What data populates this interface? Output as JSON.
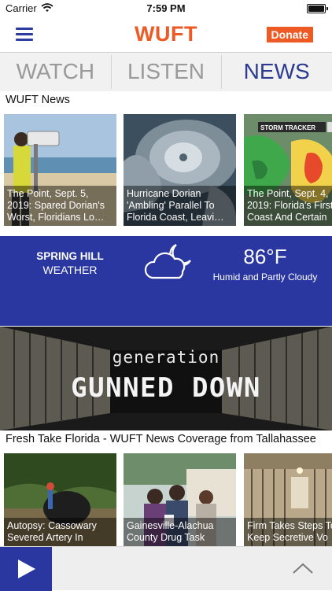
{
  "status_bar": {
    "carrier": "Carrier",
    "time": "7:59 PM"
  },
  "nav": {
    "logo": "WUFT",
    "donate_label": "Donate"
  },
  "tabs": [
    {
      "label": "WATCH"
    },
    {
      "label": "LISTEN"
    },
    {
      "label": "NEWS",
      "active": true
    }
  ],
  "news_section": {
    "title": "WUFT News",
    "items": [
      {
        "line1": "The Point, Sept. 5,",
        "line2": "2019: Spared Dorian's",
        "line3": "Worst, Floridians Lo…"
      },
      {
        "line1": "Hurricane Dorian",
        "line2": "'Ambling' Parallel To",
        "line3": "Florida Coast, Leavi…"
      },
      {
        "line1": "The Point, Sept. 4,",
        "line2": "2019: Florida's First",
        "line3": "Coast And Certain"
      }
    ]
  },
  "weather": {
    "city": "SPRING HILL",
    "label": "WEATHER",
    "temperature": "86°F",
    "condition": "Humid and Partly Cloudy",
    "icon": "partly-cloudy-night-icon"
  },
  "banner": {
    "line1": "generation",
    "line2": "GUNNED DOWN"
  },
  "fresh_take_section": {
    "title": "Fresh Take Florida - WUFT News Coverage from Tallahassee",
    "items": [
      {
        "line1": "Autopsy: Cassowary",
        "line2": "Severed Artery In"
      },
      {
        "line1": "Gainesville-Alachua",
        "line2": "County Drug Task"
      },
      {
        "line1": "Firm Takes Steps To",
        "line2": "Keep Secretive Vo"
      }
    ]
  },
  "player": {
    "play_icon": "play-icon",
    "expand_icon": "chevron-up-icon"
  },
  "colors": {
    "brand_orange": "#ee5a24",
    "brand_blue": "#2a37a0",
    "tab_active": "#2b3b8f",
    "tab_inactive": "#9a9a9a"
  }
}
